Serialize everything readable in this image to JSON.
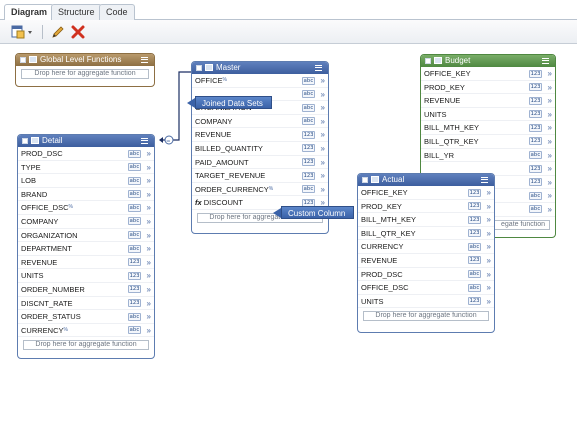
{
  "tabs": [
    "Diagram",
    "Structure",
    "Code"
  ],
  "toolbar": {
    "add_icon": "add-dataset-icon",
    "edit_icon": "pencil-icon",
    "delete_icon": "delete-x-icon"
  },
  "drop_text": "Drop here for aggregate function",
  "global": {
    "title": "Global Level Functions"
  },
  "master": {
    "title": "Master",
    "rows": [
      {
        "name": "OFFICE",
        "type": "abc",
        "sup": "%"
      },
      {
        "name": "",
        "type": "abc"
      },
      {
        "name": "ORGANIZATION",
        "type": "abc"
      },
      {
        "name": "COMPANY",
        "type": "abc"
      },
      {
        "name": "REVENUE",
        "type": "123"
      },
      {
        "name": "BILLED_QUANTITY",
        "type": "123"
      },
      {
        "name": "PAID_AMOUNT",
        "type": "123"
      },
      {
        "name": "TARGET_REVENUE",
        "type": "123"
      },
      {
        "name": "ORDER_CURRENCY",
        "type": "abc",
        "sup": "%"
      },
      {
        "name": "DISCOUNT",
        "type": "123",
        "fx": true
      }
    ]
  },
  "detail": {
    "title": "Detail",
    "rows": [
      {
        "name": "PROD_DSC",
        "type": "abc"
      },
      {
        "name": "TYPE",
        "type": "abc"
      },
      {
        "name": "LOB",
        "type": "abc"
      },
      {
        "name": "BRAND",
        "type": "abc"
      },
      {
        "name": "OFFICE_DSC",
        "type": "abc",
        "sup": "%"
      },
      {
        "name": "COMPANY",
        "type": "abc"
      },
      {
        "name": "ORGANIZATION",
        "type": "abc"
      },
      {
        "name": "DEPARTMENT",
        "type": "abc"
      },
      {
        "name": "REVENUE",
        "type": "123"
      },
      {
        "name": "UNITS",
        "type": "123"
      },
      {
        "name": "ORDER_NUMBER",
        "type": "123"
      },
      {
        "name": "DISCNT_RATE",
        "type": "123"
      },
      {
        "name": "ORDER_STATUS",
        "type": "abc"
      },
      {
        "name": "CURRENCY",
        "type": "abc",
        "sup": "%"
      }
    ]
  },
  "budget": {
    "title": "Budget",
    "rows": [
      {
        "name": "OFFICE_KEY",
        "type": "123"
      },
      {
        "name": "PROD_KEY",
        "type": "123"
      },
      {
        "name": "REVENUE",
        "type": "123"
      },
      {
        "name": "UNITS",
        "type": "123"
      },
      {
        "name": "BILL_MTH_KEY",
        "type": "123"
      },
      {
        "name": "BILL_QTR_KEY",
        "type": "123"
      },
      {
        "name": "BILL_YR",
        "type": "abc"
      },
      {
        "name": "",
        "type": "123"
      },
      {
        "name": "",
        "type": "123"
      },
      {
        "name": "",
        "type": "abc"
      },
      {
        "name": "",
        "type": "abc"
      }
    ],
    "drop_partial": "egate function"
  },
  "actual": {
    "title": "Actual",
    "rows": [
      {
        "name": "OFFICE_KEY",
        "type": "123"
      },
      {
        "name": "PROD_KEY",
        "type": "123"
      },
      {
        "name": "BILL_MTH_KEY",
        "type": "123"
      },
      {
        "name": "BILL_QTR_KEY",
        "type": "123"
      },
      {
        "name": "CURRENCY",
        "type": "abc"
      },
      {
        "name": "REVENUE",
        "type": "123"
      },
      {
        "name": "PROD_DSC",
        "type": "abc"
      },
      {
        "name": "OFFICE_DSC",
        "type": "abc"
      },
      {
        "name": "UNITS",
        "type": "123"
      }
    ]
  },
  "callouts": {
    "joined": "Joined Data Sets",
    "custom": "Custom Column"
  },
  "colors": {
    "blue": "#3d5e9e",
    "green": "#4f8841",
    "tan": "#8d6f43",
    "callout": "#3a62a8"
  }
}
